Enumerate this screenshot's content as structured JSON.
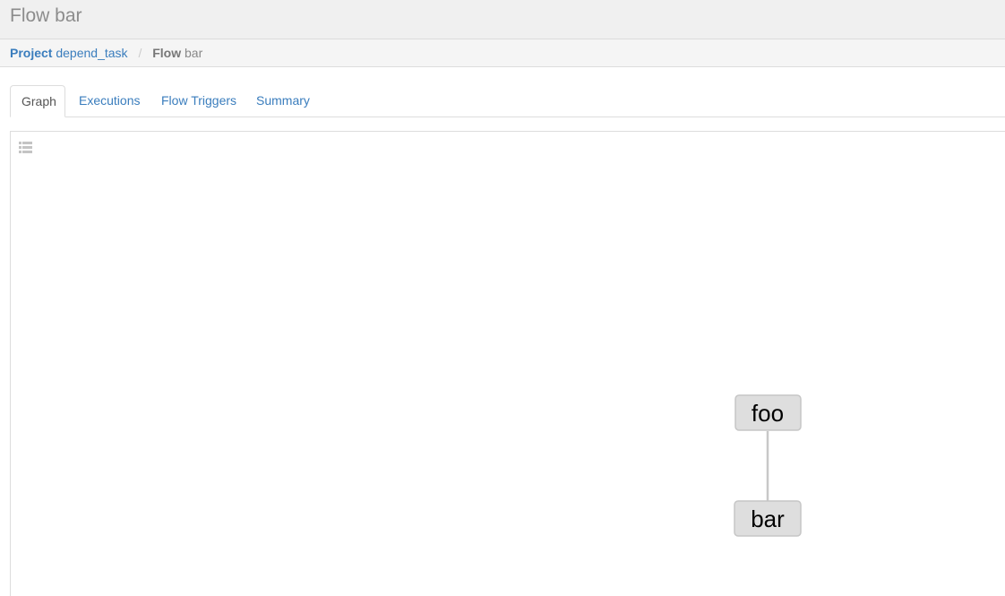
{
  "header": {
    "title": "Flow bar"
  },
  "breadcrumb": {
    "project_key": "Project",
    "project_value": "depend_task",
    "separator": "/",
    "flow_key": "Flow",
    "flow_value": "bar"
  },
  "tabs": [
    {
      "label": "Graph",
      "active": true
    },
    {
      "label": "Executions",
      "active": false
    },
    {
      "label": "Flow Triggers",
      "active": false
    },
    {
      "label": "Summary",
      "active": false
    }
  ],
  "graph": {
    "toggle_icon": "list-icon",
    "nodes": [
      {
        "id": "foo",
        "label": "foo"
      },
      {
        "id": "bar",
        "label": "bar"
      }
    ],
    "edges": [
      {
        "from": "foo",
        "to": "bar"
      }
    ],
    "colors": {
      "node_fill": "#dedede",
      "node_border": "#c6c6c6",
      "edge": "#c8c8c8"
    }
  }
}
